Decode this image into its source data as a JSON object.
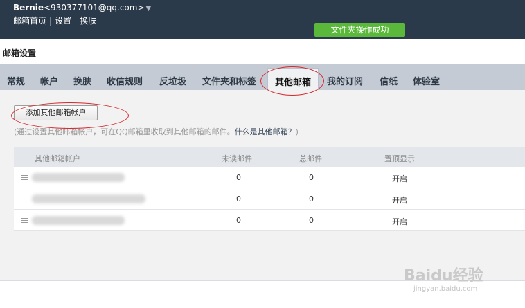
{
  "header": {
    "user_name": "Bernie",
    "user_email": "<930377101@qq.com>",
    "user_menu_arrow": "▼",
    "links": [
      "邮箱首页",
      "设置",
      "换肤"
    ],
    "sep1": "|",
    "sep2": "-",
    "toast": "文件夹操作成功"
  },
  "section_title": "邮箱设置",
  "tabs": [
    {
      "label": "常规"
    },
    {
      "label": "帐户"
    },
    {
      "label": "换肤"
    },
    {
      "label": "收信规则"
    },
    {
      "label": "反垃圾"
    },
    {
      "label": "文件夹和标签"
    },
    {
      "label": "其他邮箱"
    },
    {
      "label": "我的订阅"
    },
    {
      "label": "信纸"
    },
    {
      "label": "体验室"
    }
  ],
  "active_tab": "其他邮箱",
  "add_button": "添加其他邮箱帐户",
  "hint": {
    "text": "(通过设置其他邮箱帐户，可在QQ邮箱里收取到其他邮箱的邮件。",
    "link": "什么是其他邮箱？",
    "close": ")"
  },
  "table": {
    "headers": [
      "其他邮箱帐户",
      "未读邮件",
      "总邮件",
      "置顶显示"
    ],
    "rows": [
      {
        "unread": "0",
        "total": "0",
        "pin": "开启"
      },
      {
        "unread": "0",
        "total": "0",
        "pin": "开启"
      },
      {
        "unread": "0",
        "total": "0",
        "pin": "开启"
      }
    ]
  },
  "watermark": {
    "brand": "Baidu经验",
    "url": "jingyan.baidu.com"
  },
  "colors": {
    "header_bg": "#2b3a4a",
    "toast_bg": "#5ab83a",
    "tabbar_bg": "#c5cbd5",
    "annotation": "#d8262a"
  }
}
